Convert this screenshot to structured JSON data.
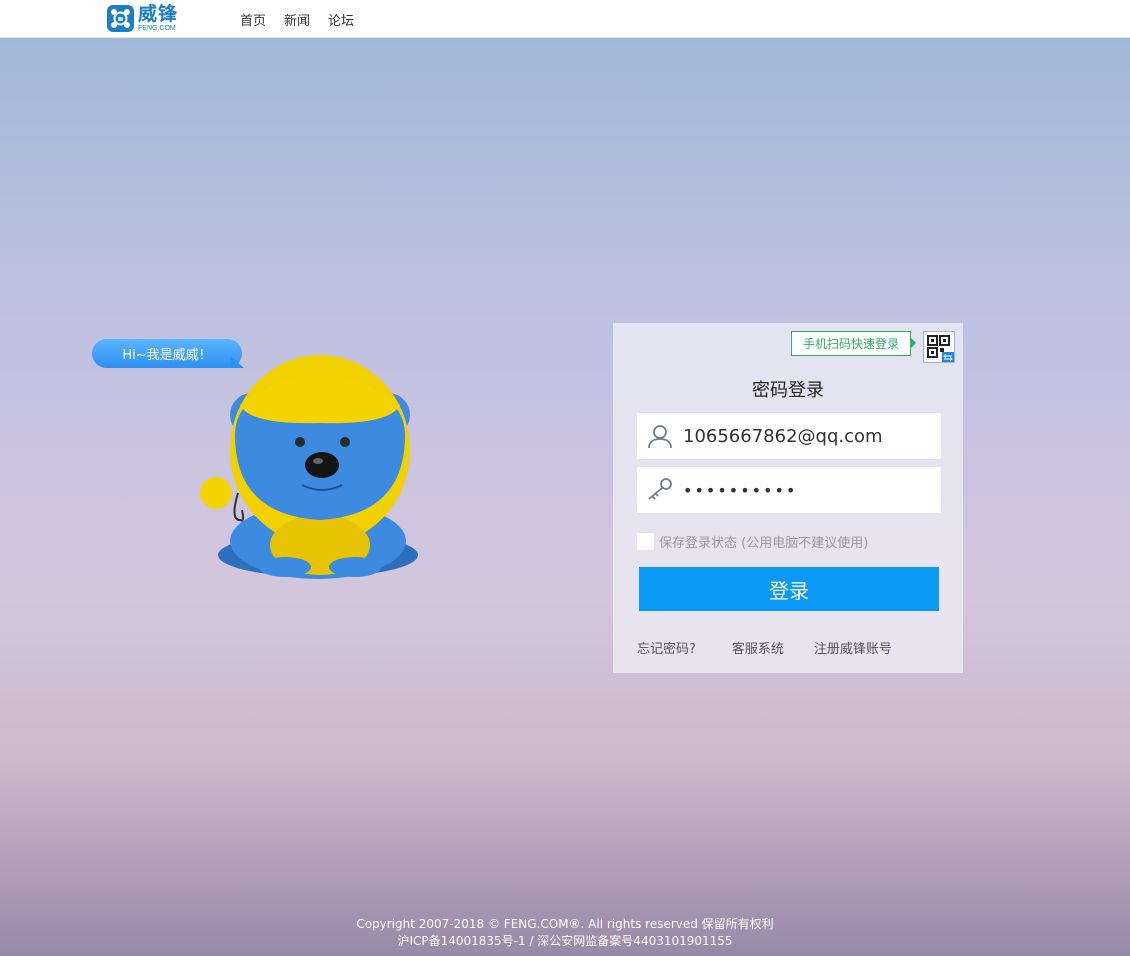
{
  "header": {
    "logo_cn": "威锋",
    "logo_en": "FENG.COM",
    "nav": [
      "首页",
      "新闻",
      "论坛"
    ]
  },
  "mascot": {
    "greeting": "Hi~我是威威！"
  },
  "login": {
    "qr_tip": "手机扫码快速登录",
    "title": "密码登录",
    "username_value": "1065667862@qq.com",
    "password_value": "••••••••••",
    "remember_label": "保存登录状态 (公用电脑不建议使用)",
    "submit_label": "登录",
    "links": [
      "忘记密码?",
      "客服系统",
      "注册威锋账号"
    ]
  },
  "footer": {
    "line1": "Copyright 2007-2018 © FENG.COM®. All rights reserved 保留所有权利",
    "line2": "沪ICP备14001835号-1 / 深公安网监备案号4403101901155"
  },
  "colors": {
    "brand": "#1a7fc4",
    "primary_button": "#0a9af5",
    "qr_accent": "#2cb067"
  },
  "icons": [
    "logo-mark-icon",
    "user-icon",
    "key-icon",
    "qr-code-icon"
  ]
}
